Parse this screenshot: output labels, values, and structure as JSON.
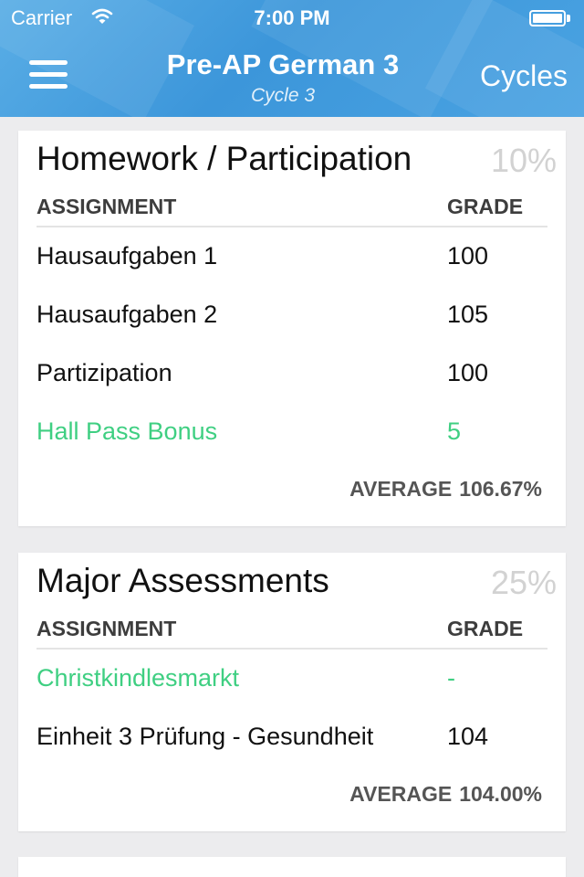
{
  "status_bar": {
    "carrier": "Carrier",
    "time": "7:00 PM",
    "wifi_icon": "wifi-icon",
    "battery_icon": "battery-icon"
  },
  "nav": {
    "title": "Pre-AP German 3",
    "subtitle": "Cycle 3",
    "menu_icon": "hamburger-menu-icon",
    "right_button": "Cycles"
  },
  "colors": {
    "header_blue": "#4aa3e2",
    "bonus_green": "#3fcf82",
    "weight_gray": "#d2d2d2",
    "background": "#ececee"
  },
  "categories": [
    {
      "title": "Homework / Participation",
      "weight": "10%",
      "columns": {
        "assignment": "ASSIGNMENT",
        "grade": "GRADE"
      },
      "rows": [
        {
          "name": "Hausaufgaben 1",
          "grade": "100"
        },
        {
          "name": "Hausaufgaben 2",
          "grade": "105"
        },
        {
          "name": "Partizipation",
          "grade": "100"
        },
        {
          "name": "Hall Pass Bonus",
          "grade": "5",
          "highlight": true
        }
      ],
      "average_label": "AVERAGE",
      "average_value": "106.67%"
    },
    {
      "title": "Major Assessments",
      "weight": "25%",
      "columns": {
        "assignment": "ASSIGNMENT",
        "grade": "GRADE"
      },
      "rows": [
        {
          "name": "Christkindlesmarkt",
          "grade": "-",
          "highlight": true
        },
        {
          "name": "Einheit 3 Prüfung - Gesundheit",
          "grade": "104"
        }
      ],
      "average_label": "AVERAGE",
      "average_value": "104.00%"
    }
  ]
}
